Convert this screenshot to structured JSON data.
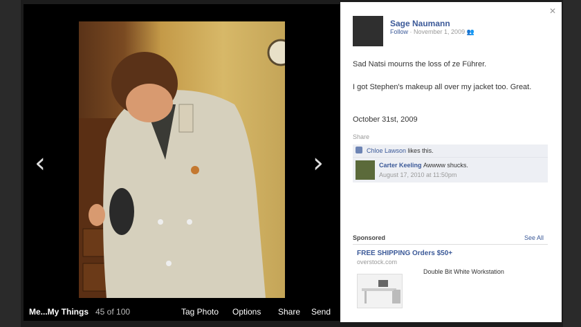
{
  "viewer": {
    "album": "Me...My Things",
    "count": "45 of 100",
    "tag_photo": "Tag Photo",
    "options": "Options",
    "share": "Share",
    "send": "Send",
    "prev_icon": "chevron-left",
    "next_icon": "chevron-right"
  },
  "post": {
    "author": "Sage Naumann",
    "follow": "Follow",
    "date": "November 1, 2009",
    "privacy_icon": "friends-icon",
    "caption1": "Sad Natsi mourns the loss of ze Führer.",
    "caption2": "I got Stephen's makeup all over my jacket too. Great.",
    "caption3": "October 31st, 2009",
    "share": "Share"
  },
  "likes": {
    "name": "Chloe Lawson",
    "text": "likes this."
  },
  "comment": {
    "author": "Carter Keeling",
    "text": "Awwww shucks.",
    "time": "August 17, 2010 at 11:50pm"
  },
  "sponsored": {
    "label": "Sponsored",
    "see_all": "See All",
    "ad_title": "FREE SHIPPING Orders $50+",
    "ad_url": "overstock.com",
    "ad_desc": "Double Bit White Workstation"
  },
  "colors": {
    "link": "#3b5998",
    "background": "#1c1c1c"
  }
}
